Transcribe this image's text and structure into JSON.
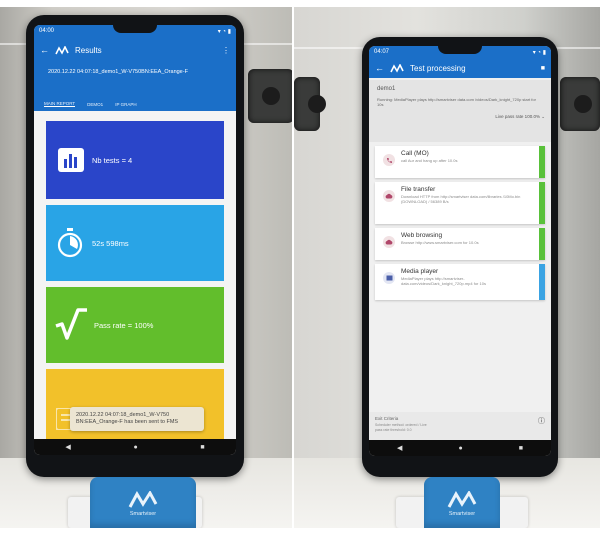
{
  "left_phone": {
    "status_time": "04:00",
    "app_title": "Results",
    "subtitle": "2020.12.22 04:07:18_demo1_W-V750BN:EEA_Orange-F",
    "tabs": [
      "MAIN REPORT",
      "DEMO1",
      "IP GRAPH"
    ],
    "tiles": [
      {
        "label": "Nb tests = 4",
        "color": "#2a45c9",
        "icon": "bar-chart-icon"
      },
      {
        "label": "52s 598ms",
        "color": "#29a4e6",
        "icon": "stopwatch-icon"
      },
      {
        "label": "Pass rate = 100%",
        "color": "#62be2c",
        "icon": "check-root-icon"
      },
      {
        "label": "",
        "color": "#f2c12a",
        "icon": "list-icon"
      }
    ],
    "toast": "2020.12.22 04:07:18_demo1_W-V750 BN:EEA_Orange-F has been sent to FMS"
  },
  "right_phone": {
    "status_time": "04:07",
    "app_title": "Test processing",
    "campaign": "demo1",
    "running_text": "Running: MediaPlayer plays http://smartviser data.com /videos/Dark_knight_720p start for 10s",
    "pass_rate": "Live pass rate 100.0%",
    "cards": [
      {
        "title": "Call (MO)",
        "desc": "call Aur and hang up after 10.0s",
        "icon": "phone-icon",
        "bar": "#59c13a"
      },
      {
        "title": "File transfer",
        "desc": "Download HTTP from http://smartviser data.com/libraries /10Mo.bin (DOWNLOAD) / 56389 B/s",
        "icon": "cloud-icon",
        "bar": "#59c13a"
      },
      {
        "title": "Web browsing",
        "desc": "Browse http://www.smartviser.com for 10.0s",
        "icon": "cloud-icon",
        "bar": "#59c13a"
      },
      {
        "title": "Media player",
        "desc": "MediaPlayer plays http://smartviser-data.com/videos/Dark_knight_720p.mp4 for 10s",
        "icon": "media-icon",
        "bar": "#3aa3e3"
      }
    ],
    "footer_title": "Exit Criteria",
    "footer_text": "Scheduler method: ordered / Live pass rate threshold: 0.0"
  },
  "dock_brand": "Smartviser"
}
